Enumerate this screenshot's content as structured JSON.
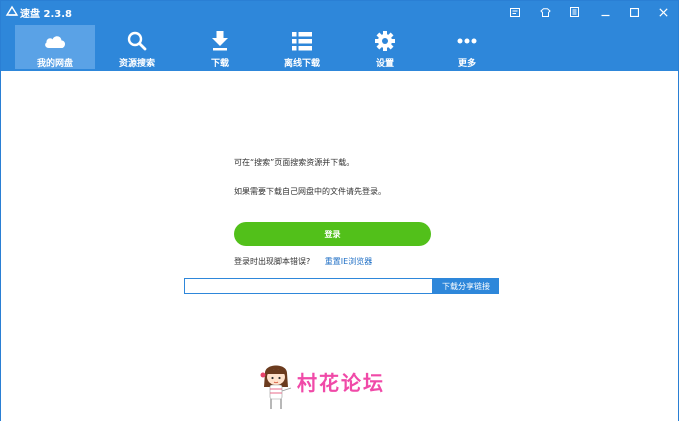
{
  "app": {
    "title": "速盘 2.3.8"
  },
  "window_controls": [
    "menu-icon",
    "skin-icon",
    "shortcut-icon",
    "minimize-icon",
    "maximize-icon",
    "close-icon"
  ],
  "toolbar": {
    "items": [
      {
        "label": "我的网盘",
        "icon": "cloud-icon",
        "active": true
      },
      {
        "label": "资源搜索",
        "icon": "search-icon",
        "active": false
      },
      {
        "label": "下载",
        "icon": "download-icon",
        "active": false
      },
      {
        "label": "离线下载",
        "icon": "list-icon",
        "active": false
      },
      {
        "label": "设置",
        "icon": "gear-icon",
        "active": false
      },
      {
        "label": "更多",
        "icon": "more-icon",
        "active": false
      }
    ]
  },
  "content": {
    "tip1": "可在“搜索”页面搜索资源并下载。",
    "tip2": "如果需要下载自己网盘中的文件请先登录。",
    "login_label": "登录",
    "error_text": "登录时出现脚本错误?",
    "reset_link": "重置IE浏览器",
    "share_input_value": "",
    "share_button": "下载分享链接"
  },
  "watermark": {
    "text": "村花论坛"
  },
  "colors": {
    "accent": "#2e87da",
    "login": "#52c01a",
    "watermark": "#f04aa8"
  }
}
